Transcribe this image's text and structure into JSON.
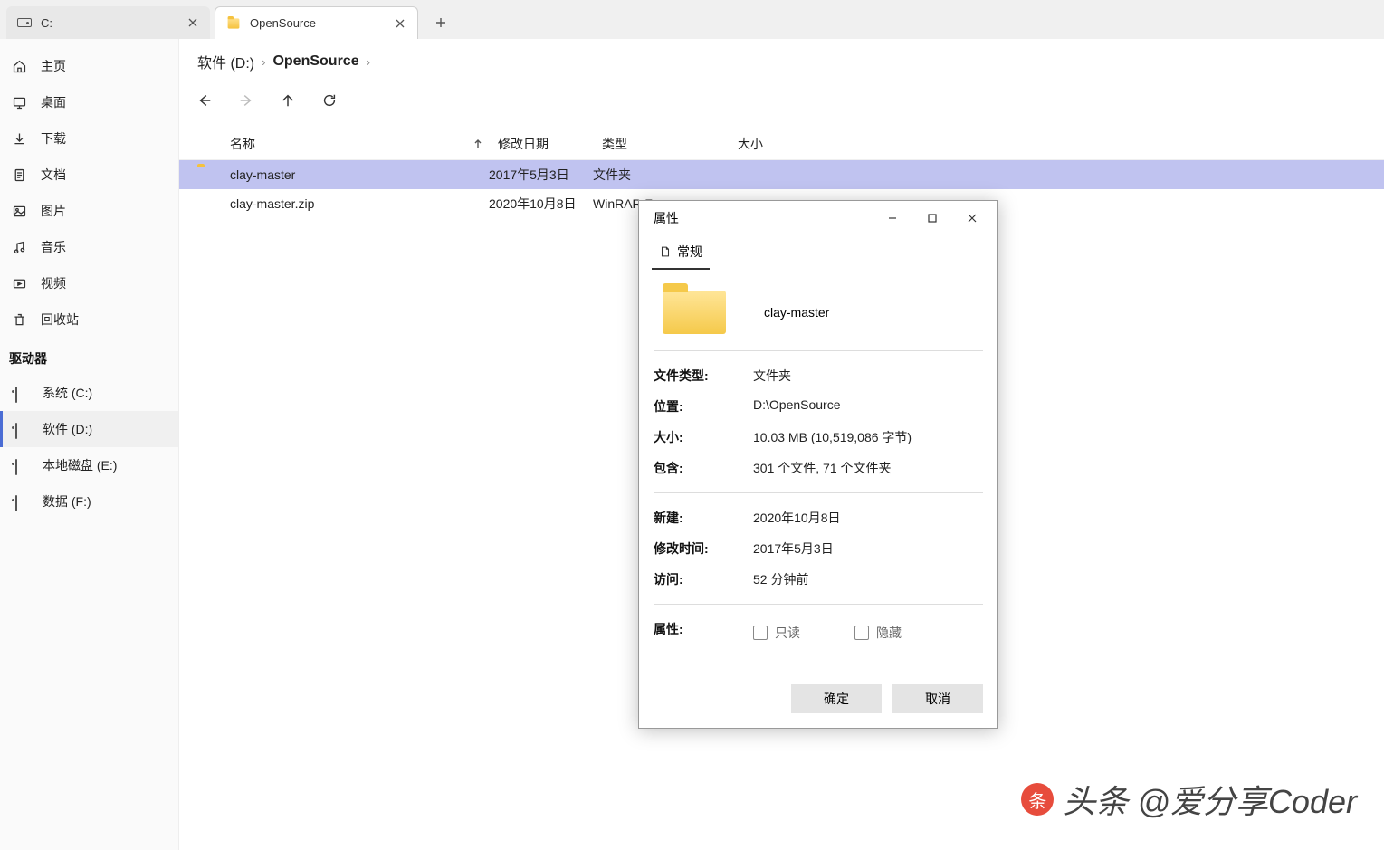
{
  "tabs": [
    {
      "label": "C:",
      "active": false
    },
    {
      "label": "OpenSource",
      "active": true
    }
  ],
  "sidebar": {
    "items": [
      {
        "label": "主页",
        "icon": "home-icon"
      },
      {
        "label": "桌面",
        "icon": "desktop-icon"
      },
      {
        "label": "下载",
        "icon": "download-icon"
      },
      {
        "label": "文档",
        "icon": "document-icon"
      },
      {
        "label": "图片",
        "icon": "picture-icon"
      },
      {
        "label": "音乐",
        "icon": "music-icon"
      },
      {
        "label": "视频",
        "icon": "video-icon"
      },
      {
        "label": "回收站",
        "icon": "trash-icon"
      }
    ],
    "drives_header": "驱动器",
    "drives": [
      {
        "label": "系统 (C:)",
        "active": false
      },
      {
        "label": "软件 (D:)",
        "active": true
      },
      {
        "label": "本地磁盘 (E:)",
        "active": false
      },
      {
        "label": "数据 (F:)",
        "active": false
      }
    ]
  },
  "breadcrumb": [
    {
      "label": "软件 (D:)"
    },
    {
      "label": "OpenSource"
    }
  ],
  "columns": {
    "name": "名称",
    "date": "修改日期",
    "type": "类型",
    "size": "大小"
  },
  "files": [
    {
      "name": "clay-master",
      "date": "2017年5月3日",
      "type": "文件夹",
      "icon": "folder",
      "selected": true
    },
    {
      "name": "clay-master.zip",
      "date": "2020年10月8日",
      "type": "WinRAR Z",
      "icon": "zip",
      "selected": false
    }
  ],
  "dialog": {
    "title": "属性",
    "tab": "常规",
    "item_name": "clay-master",
    "rows": {
      "filetype_label": "文件类型:",
      "filetype_value": "文件夹",
      "location_label": "位置:",
      "location_value": "D:\\OpenSource",
      "size_label": "大小:",
      "size_value": "10.03 MB (10,519,086 字节)",
      "contains_label": "包含:",
      "contains_value": "301 个文件, 71 个文件夹",
      "created_label": "新建:",
      "created_value": "2020年10月8日",
      "modified_label": "修改时间:",
      "modified_value": "2017年5月3日",
      "accessed_label": "访问:",
      "accessed_value": "52 分钟前",
      "attr_label": "属性:",
      "readonly": "只读",
      "hidden": "隐藏"
    },
    "ok": "确定",
    "cancel": "取消"
  },
  "watermark": "头条 @爱分享Coder"
}
